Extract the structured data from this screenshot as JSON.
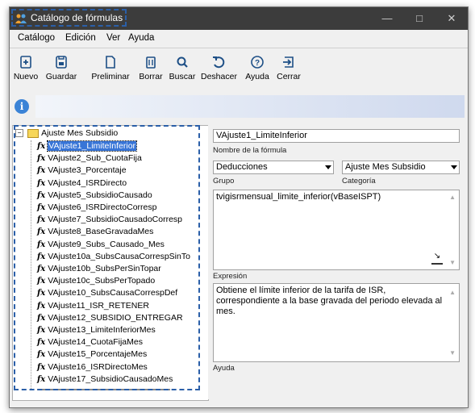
{
  "window": {
    "title": "Catálogo de fórmulas",
    "controls": [
      "—",
      "□",
      "✕"
    ]
  },
  "menu": [
    {
      "label": "Catálogo",
      "accel": "C"
    },
    {
      "label": "Edición",
      "accel": "E"
    },
    {
      "label": "Ver",
      "accel": "V"
    },
    {
      "label": "Ayuda",
      "accel": "u"
    }
  ],
  "toolbar": {
    "nuevo": "Nuevo",
    "guardar": "Guardar",
    "preliminar": "Preliminar",
    "borrar": "Borrar",
    "buscar": "Buscar",
    "deshacer": "Deshacer",
    "ayuda": "Ayuda",
    "cerrar": "Cerrar"
  },
  "tree": {
    "root": "Ajuste Mes Subsidio",
    "items": [
      "VAjuste1_LimiteInferior",
      "VAjuste2_Sub_CuotaFija",
      "VAjuste3_Porcentaje",
      "VAjuste4_ISRDirecto",
      "VAjuste5_SubsidioCausado",
      "VAjuste6_ISRDirectoCorresp",
      "VAjuste7_SubsidioCausadoCorresp",
      "VAjuste8_BaseGravadaMes",
      "VAjuste9_Subs_Causado_Mes",
      "VAjuste10a_SubsCausaCorrespSinTo",
      "VAjuste10b_SubsPerSinTopar",
      "VAjuste10c_SubsPerTopado",
      "VAjuste10_SubsCausaCorrespDef",
      "VAjuste11_ISR_RETENER",
      "VAjuste12_SUBSIDIO_ENTREGAR",
      "VAjuste13_LimiteInferiorMes",
      "VAjuste14_CuotaFijaMes",
      "VAjuste15_PorcentajeMes",
      "VAjuste16_ISRDirectoMes",
      "VAjuste17_SubsidioCausadoMes"
    ],
    "selected_index": 0
  },
  "form": {
    "nombre_value": "VAjuste1_LimiteInferior",
    "nombre_caption": "Nombre de la fórmula",
    "grupo_value": "Deducciones",
    "grupo_caption": "Grupo",
    "categoria_value": "Ajuste Mes Subsidio",
    "categoria_caption": "Categoría",
    "expresion_value": "tvigisrmensual_limite_inferior(vBaseISPT)",
    "expresion_caption": "Expresión",
    "ayuda_value": "Obtiene el límite inferior de la tarifa de ISR, correspondiente a la base gravada del periodo elevada al mes.",
    "ayuda_caption": "Ayuda"
  },
  "colors": {
    "titlebar": "#3c3c3c",
    "selection": "#3875d7",
    "dash_highlight": "#2b5fa8",
    "info_icon": "#3b83d6"
  }
}
